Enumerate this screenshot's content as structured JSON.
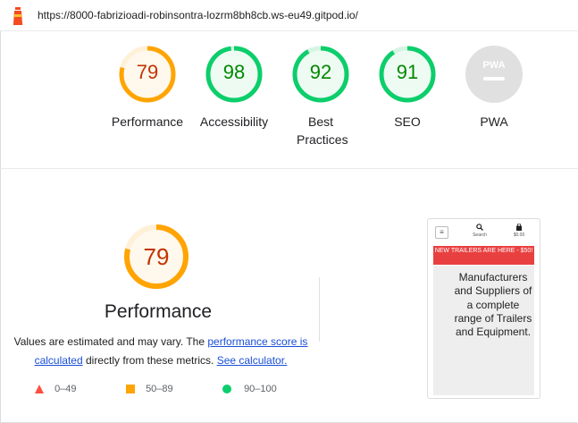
{
  "header": {
    "url": "https://8000-fabrizioadi-robinsontra-lozrm8bh8cb.ws-eu49.gitpod.io/"
  },
  "colors": {
    "average": "#ffa400",
    "average_text": "#c33300",
    "pass": "#0cce6b",
    "pass_text": "#008800",
    "fail": "#ff4e42",
    "na": "#e0e0e0"
  },
  "gauges": [
    {
      "score": "79",
      "label": "Performance",
      "rating": "average",
      "value": 0.79
    },
    {
      "score": "98",
      "label": "Accessibility",
      "rating": "pass",
      "value": 0.98
    },
    {
      "score": "92",
      "label": "Best Practices",
      "rating": "pass",
      "value": 0.92
    },
    {
      "score": "91",
      "label": "SEO",
      "rating": "pass",
      "value": 0.91
    },
    {
      "score": "",
      "label": "PWA",
      "rating": "na",
      "badge": "PWA"
    }
  ],
  "performance": {
    "score": "79",
    "value": 0.79,
    "title": "Performance",
    "desc_prefix": "Values are estimated and may vary. The ",
    "desc_link1": "performance score is calculated",
    "desc_middle": " directly from these metrics. ",
    "desc_link2": "See calculator.",
    "legend": [
      {
        "label": "0–49",
        "shape": "triangle-icon"
      },
      {
        "label": "50–89",
        "shape": "square-icon"
      },
      {
        "label": "90–100",
        "shape": "circle-icon"
      }
    ]
  },
  "screenshot": {
    "search_label": "Search",
    "bag_label": "$0.00",
    "banner": "NEW TRAILERS ARE HERE -  $50!",
    "hero": "Manufacturers and Suppliers of a complete range of Trailers and Equipment."
  }
}
